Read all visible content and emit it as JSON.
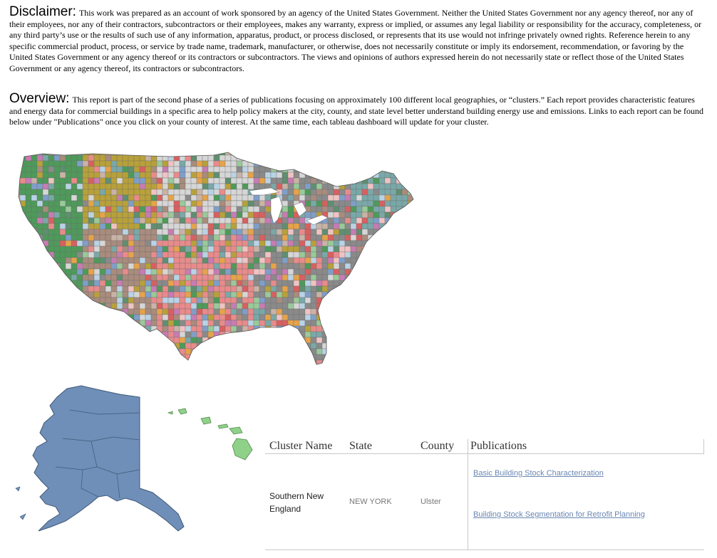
{
  "disclaimer": {
    "heading": "Disclaimer:",
    "text": "This work was prepared as an account of work sponsored by an agency of the United States Government. Neither the United States Government nor any agency thereof, nor any of their employees, nor any of their contractors, subcontractors or their employees, makes any warranty, express or implied, or assumes any legal liability or responsibility for the accuracy, completeness, or any third party’s use or the results of such use of any information, apparatus, product, or process disclosed, or represents that its use would not infringe privately owned rights. Reference herein to any specific commercial product, process, or service by trade name, trademark, manufacturer, or otherwise, does not necessarily constitute or imply its endorsement, recommendation, or favoring by the United States Government or any agency thereof or its contractors or subcontractors. The views and opinions of authors expressed herein do not necessarily state or reflect those of the United States Government or any agency thereof, its contractors or subcontractors."
  },
  "overview": {
    "heading": "Overview:",
    "text": "This report is part of the second phase of a series of publications focusing on approximately 100 different local geographies, or “clusters.” Each report provides characteristic features and energy data for commercial buildings in a specific area to help policy makers at the city, county, and state level better understand building energy use and emissions. Links to each report can be found below under \"Publications\" once you click on your county of interest.  At the same time, each tableau dashboard will update for your cluster."
  },
  "map": {
    "colors": [
      "#4e9a5a",
      "#b8a13a",
      "#a98c7d",
      "#e98b8b",
      "#d86060",
      "#8a8a8a",
      "#9ac99a",
      "#c9b3a6",
      "#c77cb3",
      "#e6a34a",
      "#7f9fc9",
      "#7aa8a8",
      "#d6d6d6",
      "#b9d3e6",
      "#f0c3c3",
      "#5f8f6f"
    ],
    "alaska_color": "#6f8fb8",
    "hawaii_color": "#90d18a"
  },
  "table": {
    "headers": {
      "cluster_name": "Cluster Name",
      "state": "State",
      "county": "County",
      "publications": "Publications"
    },
    "row": {
      "cluster_name": "Southern New England",
      "state": "NEW YORK",
      "county": "Ulster"
    },
    "publications": [
      "Basic Building Stock Characterization",
      "Building Stock Segmentation for Retrofit Planning"
    ]
  }
}
